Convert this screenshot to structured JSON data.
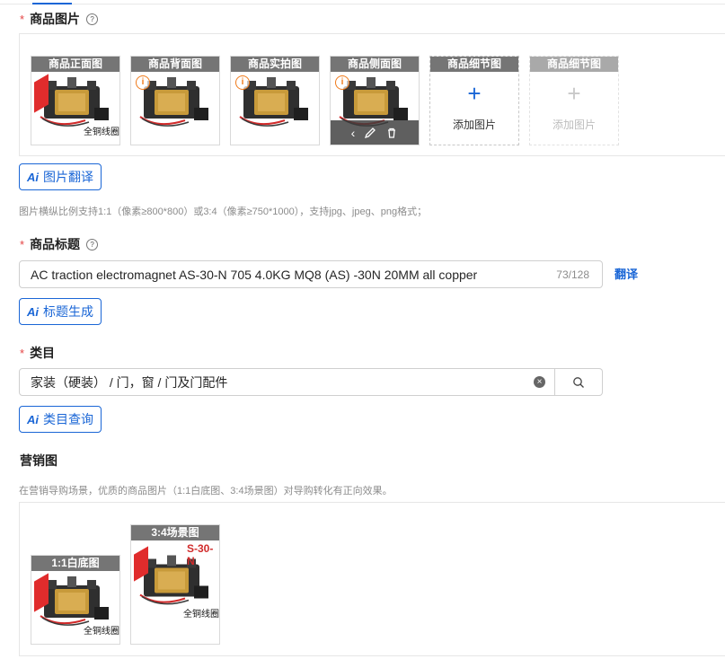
{
  "images_section": {
    "label": "商品图片",
    "required_mark": "*",
    "slots": [
      {
        "caption": "商品正面图"
      },
      {
        "caption": "商品背面图"
      },
      {
        "caption": "商品实拍图"
      },
      {
        "caption": "商品侧面图"
      },
      {
        "caption": "商品细节图",
        "add_label": "添加图片"
      },
      {
        "caption": "商品细节图",
        "add_label": "添加图片"
      }
    ],
    "translate_button": "图片翻译",
    "hint": "图片横纵比例支持1:1（像素≥800*800）或3:4（像素≥750*1000），支持jpg、jpeg、png格式；",
    "product_overlay_text": "全铜线圈",
    "product_model_text": "S-30-N"
  },
  "title_section": {
    "label": "商品标题",
    "required_mark": "*",
    "value": "AC traction electromagnet AS-30-N 705 4.0KG MQ8 (AS) -30N 20MM all copper",
    "counter": "73/128",
    "translate_link": "翻译",
    "generate_button": "标题生成"
  },
  "category_section": {
    "label": "类目",
    "required_mark": "*",
    "value": "家装（硬装） / 门，窗 / 门及门配件",
    "query_button": "类目查询"
  },
  "marketing_section": {
    "label": "营销图",
    "hint": "在营销导购场景，优质的商品图片（1:1白底图、3:4场景图）对导购转化有正向效果。",
    "slots": [
      {
        "caption": "1:1白底图"
      },
      {
        "caption": "3:4场景图"
      }
    ]
  },
  "ai_icon_text": "Ai",
  "colors": {
    "accent": "#1a66d6",
    "required": "#e54545",
    "caption_bg": "#757575"
  }
}
